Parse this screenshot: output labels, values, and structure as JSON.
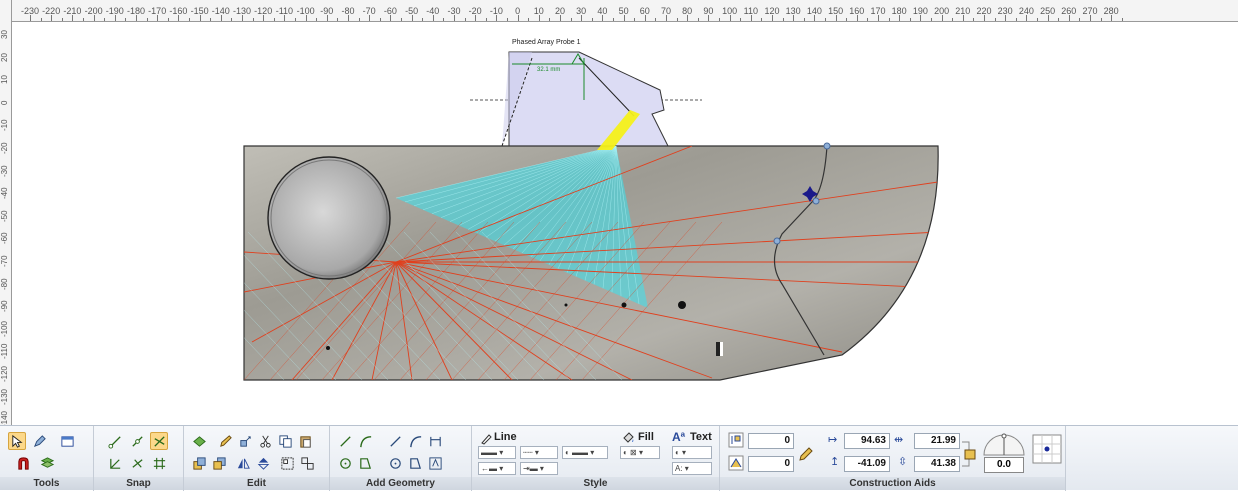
{
  "ruler": {
    "h_labels": [
      "-230",
      "-220",
      "-210",
      "-200",
      "-190",
      "-180",
      "-170",
      "-160",
      "-150",
      "-140",
      "-130",
      "-120",
      "-110",
      "-100",
      "-90",
      "-80",
      "-70",
      "-60",
      "-50",
      "-40",
      "-30",
      "-20",
      "-10",
      "0",
      "10",
      "20",
      "30",
      "40",
      "50",
      "60",
      "70",
      "80",
      "90",
      "100",
      "110",
      "120",
      "130",
      "140",
      "150",
      "160",
      "170",
      "180",
      "190",
      "200",
      "210",
      "220",
      "230",
      "240",
      "250",
      "260",
      "270",
      "280"
    ],
    "v_labels": [
      "30",
      "20",
      "10",
      "0",
      "-10",
      "-20",
      "-30",
      "-40",
      "-50",
      "-60",
      "-70",
      "-80",
      "-90",
      "-100",
      "-110",
      "-120",
      "-130",
      "-140"
    ]
  },
  "drawing": {
    "probe_label": "Phased Array Probe 1",
    "probe_dimension": "32.1 mm",
    "colors": {
      "block_fill": "#a9a79e",
      "ray": "#e0401e",
      "beam_cyan": "#38e4f0",
      "beam_yellow": "#f4f01a",
      "probe_fill": "#dcdcf4",
      "dimension": "#1a8a2a"
    }
  },
  "ribbon": {
    "groups": {
      "tools": "Tools",
      "snap": "Snap",
      "edit": "Edit",
      "add_geometry": "Add Geometry",
      "style": "Style",
      "construction_aids": "Construction Aids"
    },
    "style": {
      "line_label": "Line",
      "fill_label": "Fill",
      "text_label": "Text"
    },
    "text_fields": {
      "top_value": "0",
      "bottom_value": "0"
    },
    "construction": {
      "x_value": "94.63",
      "width_value": "21.99",
      "y_value": "-41.09",
      "height_value": "41.38",
      "angle_value": "0.0"
    }
  }
}
